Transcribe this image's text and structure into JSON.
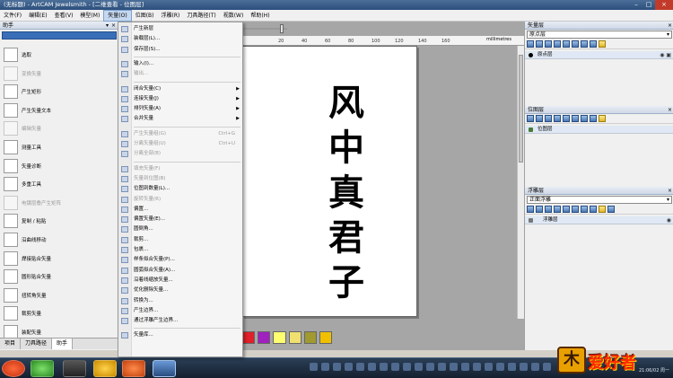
{
  "window": {
    "title": "(无标题) - ArtCAM Jewelsmith - [二维查看 - 位图层]"
  },
  "menubar": {
    "items": [
      "文件(F)",
      "编辑(E)",
      "查看(V)",
      "模型(M)",
      "矢量(O)",
      "位图(B)",
      "浮雕(R)",
      "刀具路径(T)",
      "视数(W)",
      "帮助(H)"
    ],
    "active": "矢量(O)"
  },
  "left_panel": {
    "title": "助手",
    "tools": [
      {
        "label": "选取",
        "dim": false,
        "icon": "pointer-icon"
      },
      {
        "label": "变换矢量",
        "dim": true,
        "icon": "transform-icon"
      },
      {
        "label": "产生矩形",
        "dim": false,
        "icon": "rectangle-icon"
      },
      {
        "label": "产生矢量文本",
        "dim": false,
        "icon": "text-icon"
      },
      {
        "label": "编辑矢量",
        "dim": true,
        "icon": "edit-vector-icon"
      },
      {
        "label": "测量工具",
        "dim": false,
        "icon": "measure-icon"
      },
      {
        "label": "矢量诊断",
        "dim": false,
        "icon": "diagnose-icon"
      },
      {
        "label": "多重工具",
        "dim": false,
        "icon": "multi-tool-icon"
      },
      {
        "label": "电镀层叠产生矩阵",
        "dim": true,
        "icon": "array-icon"
      },
      {
        "label": "复制 / 粘贴",
        "dim": false,
        "icon": "copy-icon"
      },
      {
        "label": "沿曲线移动",
        "dim": false,
        "icon": "move-along-icon"
      },
      {
        "label": "焊接贴合矢量",
        "dim": false,
        "icon": "weld-icon"
      },
      {
        "label": "圆形贴合矢量",
        "dim": false,
        "icon": "circle-fit-icon"
      },
      {
        "label": "扭转角矢量",
        "dim": false,
        "icon": "twist-icon"
      },
      {
        "label": "裁剪矢量",
        "dim": false,
        "icon": "trim-icon"
      },
      {
        "label": "装配矢量",
        "dim": false,
        "icon": "assemble-icon"
      }
    ],
    "tabs": [
      "项目",
      "刀具路径",
      "助手"
    ],
    "active_tab": "助手"
  },
  "vector_menu": {
    "items": [
      {
        "label": "产生新层",
        "dim": false
      },
      {
        "label": "装载层(L)...",
        "dim": false
      },
      {
        "label": "保存层(S)...",
        "dim": false
      },
      {
        "sep": true
      },
      {
        "label": "输入(I)...",
        "dim": false
      },
      {
        "label": "输出...",
        "dim": true
      },
      {
        "sep": true
      },
      {
        "label": "闭合矢量(C)",
        "dim": false,
        "sub": true
      },
      {
        "label": "连接矢量(J)",
        "dim": false,
        "sub": true
      },
      {
        "label": "排列矢量(A)",
        "dim": false,
        "sub": true
      },
      {
        "label": "合并矢量",
        "dim": false,
        "sub": true
      },
      {
        "sep": true
      },
      {
        "label": "产生矢量组(G)",
        "dim": true,
        "shortcut": "Ctrl+G"
      },
      {
        "label": "分离矢量组(U)",
        "dim": true,
        "shortcut": "Ctrl+U"
      },
      {
        "label": "分离全部(B)",
        "dim": true
      },
      {
        "sep": true
      },
      {
        "label": "填充矢量(F)",
        "dim": true
      },
      {
        "label": "矢量到位图(B)",
        "dim": true
      },
      {
        "label": "位图到数量(L)...",
        "dim": false
      },
      {
        "label": "旋转矢量(R)",
        "dim": true
      },
      {
        "label": "偏置...",
        "dim": false
      },
      {
        "label": "偏置矢量(E)...",
        "dim": false
      },
      {
        "label": "圆倒角...",
        "dim": false
      },
      {
        "label": "裁剪...",
        "dim": false
      },
      {
        "label": "包裹...",
        "dim": false
      },
      {
        "label": "样条拟合矢量(P)...",
        "dim": false
      },
      {
        "label": "圆弧拟合矢量(A)...",
        "dim": false
      },
      {
        "label": "沿着线缩放矢量...",
        "dim": false
      },
      {
        "label": "优化删除矢量...",
        "dim": false
      },
      {
        "label": "转换为...",
        "dim": false
      },
      {
        "label": "产生边界...",
        "dim": false
      },
      {
        "label": "通过浮雕产生边界...",
        "dim": false
      },
      {
        "sep": true
      },
      {
        "label": "矢量库...",
        "dim": false
      }
    ]
  },
  "ruler": {
    "unit": "millimetres",
    "ticks": [
      "20",
      "40",
      "60",
      "80",
      "100",
      "120",
      "140",
      "160"
    ]
  },
  "document": {
    "calligraphy": [
      "风",
      "中",
      "真",
      "君",
      "子"
    ]
  },
  "palette": {
    "colors": [
      "#e0202a",
      "#a020c0",
      "#ffff70",
      "#f0e070",
      "#a09a30",
      "#f0c000"
    ]
  },
  "right_panel": {
    "vector_layers": {
      "title": "矢量层",
      "combo": "原点层",
      "row": "原点层"
    },
    "bitmap_layers": {
      "title": "位图层",
      "row": "位图层"
    },
    "relief_layers": {
      "title": "浮雕层",
      "combo": "正面浮雕",
      "row": "浮雕层"
    }
  },
  "watermark": {
    "text": "爱好者"
  },
  "clock": {
    "text": "21:06/02 周一"
  }
}
